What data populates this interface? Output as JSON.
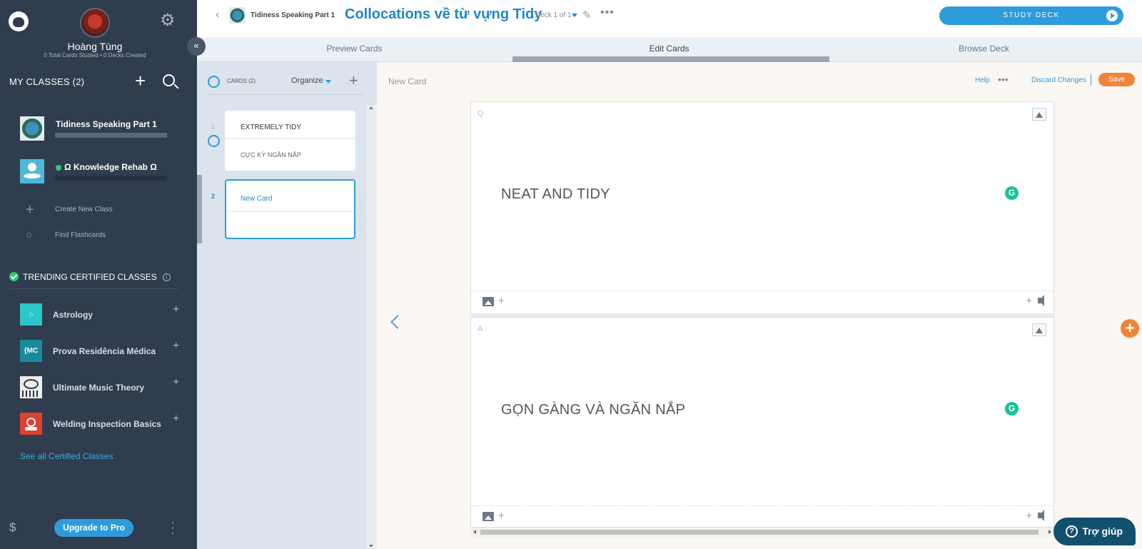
{
  "sidebar": {
    "user_name": "Hoàng Tùng",
    "user_stats": "0 Total Cards Studied • 0 Decks Created",
    "my_classes_label": "MY CLASSES (2)",
    "classes": [
      {
        "name": "Tidiness Speaking Part 1"
      },
      {
        "name": "Ω Knowledge Rehab Ω"
      }
    ],
    "create_class_label": "Create New Class",
    "find_flashcards_label": "Find Flashcards",
    "trending_label": "TRENDING CERTIFIED CLASSES",
    "certified": [
      {
        "name": "Astrology",
        "color": "#2ac6c8"
      },
      {
        "name": "Prova Residência Médica",
        "color": "#1a8a9a",
        "thumb_text": "{MC"
      },
      {
        "name": "Ultimate Music Theory",
        "color": "#eeeeee"
      },
      {
        "name": "Welding Inspection Basics",
        "color": "#e0402d"
      }
    ],
    "see_all_label": "See all Certified Classes",
    "currency_icon": "$",
    "upgrade_label": "Upgrade to Pro"
  },
  "topbar": {
    "breadcrumb_class": "Tidiness Speaking Part 1",
    "deck_title": "Collocations về từ vựng Tidy",
    "deck_count": "Deck 1 of 1",
    "study_label": "STUDY DECK"
  },
  "tabs": [
    {
      "label": "Preview Cards"
    },
    {
      "label": "Edit Cards"
    },
    {
      "label": "Browse Deck"
    }
  ],
  "card_list": {
    "count_label": "CARDS (2)",
    "organize_label": "Organize",
    "cards": [
      {
        "number": "1",
        "question": "EXTREMELY TIDY",
        "answer": "CỰC KỲ NGĂN NẮP"
      },
      {
        "number": "2",
        "question": "New Card",
        "answer": ""
      }
    ]
  },
  "editor": {
    "card_label": "New Card",
    "help_label": "Help",
    "discard_label": "Discard Changes",
    "save_label": "Save",
    "question_tag": "Q",
    "answer_tag": "A",
    "question_text": "NEAT AND TIDY",
    "answer_text": "GỌN GÀNG VÀ NGĂN NẮP",
    "accent_color": "#2e9cdb",
    "save_color": "#f0843a"
  },
  "help_widget": {
    "label": "Trợ giúp"
  }
}
